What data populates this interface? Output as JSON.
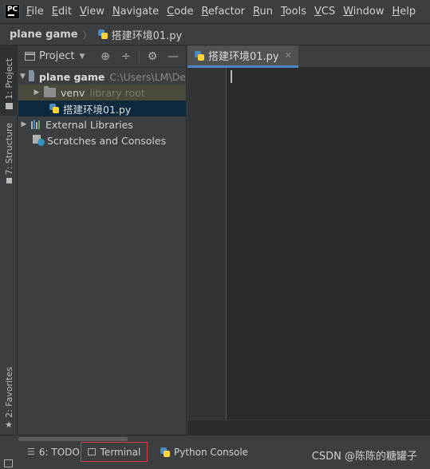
{
  "menu": {
    "logo": "PC",
    "items": [
      {
        "mn": "F",
        "rest": "ile"
      },
      {
        "mn": "E",
        "rest": "dit"
      },
      {
        "mn": "V",
        "rest": "iew"
      },
      {
        "mn": "N",
        "rest": "avigate"
      },
      {
        "mn": "C",
        "rest": "ode"
      },
      {
        "mn": "R",
        "rest": "efactor"
      },
      {
        "mn": "R",
        "rest": "un"
      },
      {
        "mn": "T",
        "rest": "ools"
      },
      {
        "mn": "V",
        "rest": "CS"
      },
      {
        "mn": "W",
        "rest": "indow"
      },
      {
        "mn": "H",
        "rest": "elp"
      }
    ]
  },
  "breadcrumb": {
    "project": "plane game",
    "separator": "〉",
    "file": "搭建环境01.py"
  },
  "left_strip": {
    "project_tab": "1: Project",
    "structure_tab": "7: Structure",
    "favorites_tab": "2: Favorites"
  },
  "project_panel": {
    "title": "Project",
    "tools": {
      "locate": "⊕",
      "collapse": "÷",
      "settings": "⚙",
      "hide": "—"
    },
    "tree": {
      "root_name": "plane game",
      "root_path": "C:\\Users\\LM\\De",
      "venv_name": "venv",
      "venv_note": "library root",
      "file_name": "搭建环境01.py",
      "external": "External Libraries",
      "scratches": "Scratches and Consoles"
    }
  },
  "editor": {
    "tab_label": "搭建环境01.py",
    "tab_close": "✕"
  },
  "bottom": {
    "todo_label": "6: TODO",
    "terminal_label": "Terminal",
    "python_console_label": "Python Console",
    "watermark": "CSDN @陈陈的糖罐子"
  },
  "colors": {
    "background": "#3c3f41",
    "editor_bg": "#2b2b2b",
    "selection": "#0d293e",
    "tab_underline": "#4a88c7",
    "terminal_highlight": "#e0383e"
  }
}
